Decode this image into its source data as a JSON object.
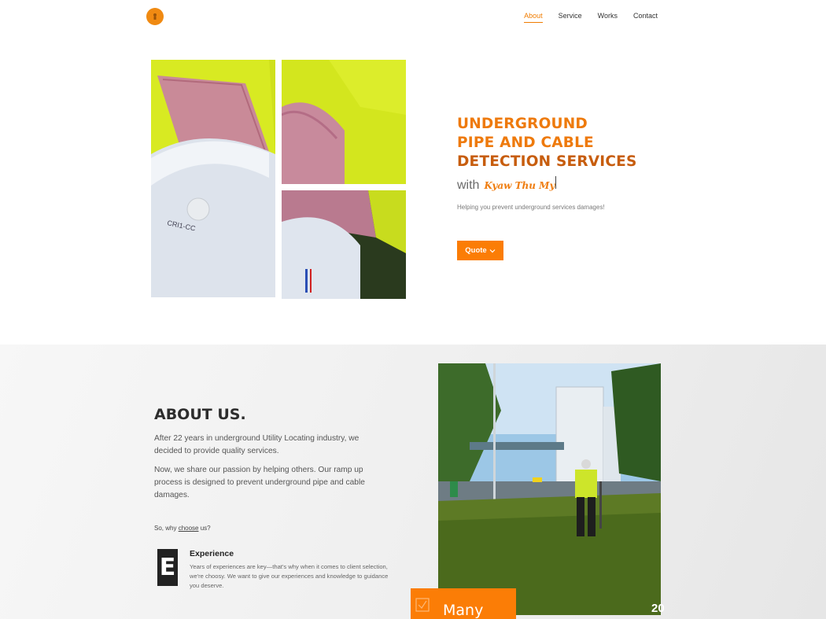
{
  "nav": {
    "logo_icon": "round-orange-logo-icon",
    "links": [
      "About",
      "Service",
      "Works",
      "Contact"
    ],
    "active": "About"
  },
  "hero": {
    "title_line1": "UNDERGROUND",
    "title_line2": "PIPE AND CABLE",
    "title_line3": "DETECTION SERVICES",
    "with_word": "with",
    "typed_name": "Kyaw Thu My",
    "subtitle": "Helping you prevent underground services damages!",
    "quote_button": "Quote",
    "quote_icon": "chevron-down-icon"
  },
  "about": {
    "title": "ABOUT US.",
    "paragraph1": "After 22 years in underground Utility Locating industry, we decided to provide quality services.",
    "paragraph2": "Now, we share our passion by helping others. Our ramp up process is designed to prevent underground pipe and cable damages.",
    "why_prefix": "So, why ",
    "why_link": "choose",
    "why_suffix": " us?",
    "experience": {
      "icon_letter": "E",
      "title": "Experience",
      "text": "Years of experiences are key—that's why when it comes to client selection, we're choosy. We want to give our experiences and knowledge to guidance you deserve."
    },
    "photo_caption": "20",
    "card_label": "Many",
    "card_icon": "checkbox-icon"
  },
  "colors": {
    "accent": "#fb7d06",
    "title_orange": "#ee7a0c",
    "title_dark_orange": "#c75d0e"
  }
}
